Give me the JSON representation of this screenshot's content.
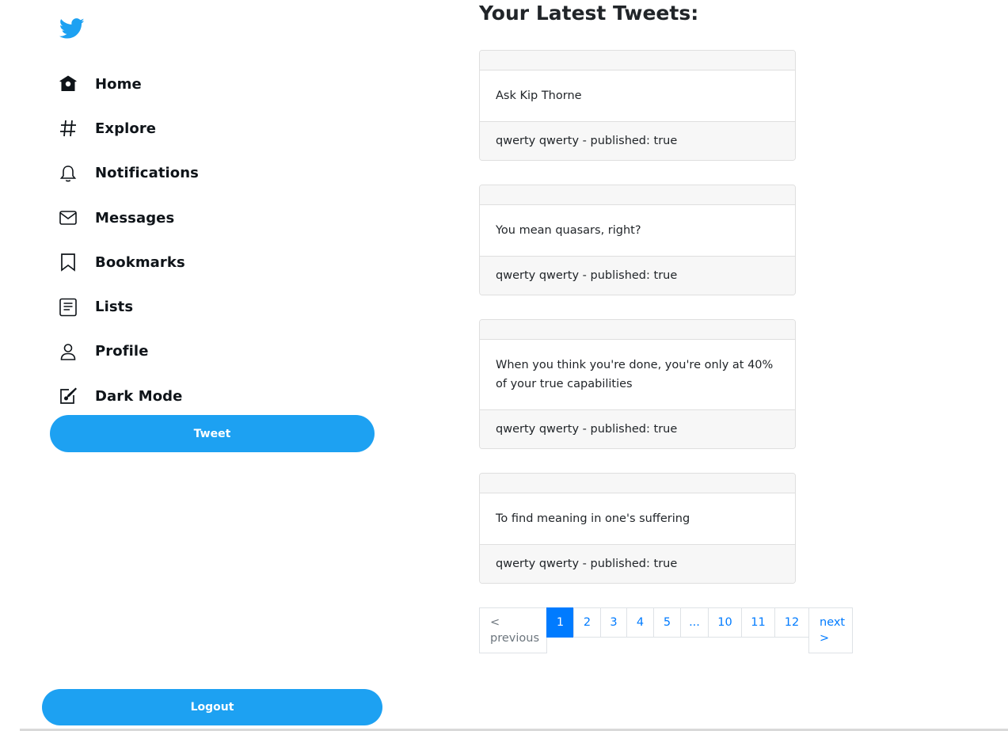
{
  "app": {
    "brand_color": "#1da1f2",
    "logo_icon": "twitter-bird-icon"
  },
  "sidebar": {
    "items": [
      {
        "label": "Home",
        "icon": "home-icon"
      },
      {
        "label": "Explore",
        "icon": "hashtag-icon"
      },
      {
        "label": "Notifications",
        "icon": "bell-icon"
      },
      {
        "label": "Messages",
        "icon": "envelope-icon"
      },
      {
        "label": "Bookmarks",
        "icon": "bookmark-icon"
      },
      {
        "label": "Lists",
        "icon": "list-icon"
      },
      {
        "label": "Profile",
        "icon": "person-icon"
      },
      {
        "label": "Dark Mode",
        "icon": "pencil-square-icon"
      }
    ],
    "tweet_button": "Tweet",
    "logout_button": "Logout"
  },
  "main": {
    "title": "Your Latest Tweets:",
    "tweets": [
      {
        "text": "Ask Kip Thorne",
        "footer": "qwerty qwerty - published: true"
      },
      {
        "text": "You mean quasars, right?",
        "footer": "qwerty qwerty - published: true"
      },
      {
        "text": "When you think you're done, you're only at 40% of your true capabilities",
        "footer": "qwerty qwerty - published: true"
      },
      {
        "text": "To find meaning in one's suffering",
        "footer": "qwerty qwerty - published: true"
      }
    ]
  },
  "pagination": {
    "previous_line1": "<",
    "previous_line2": "previous",
    "pages": [
      "1",
      "2",
      "3",
      "4",
      "5",
      "...",
      "10",
      "11",
      "12"
    ],
    "active_page": "1",
    "next_line1": "next",
    "next_line2": ">",
    "active_color": "#007bff"
  }
}
